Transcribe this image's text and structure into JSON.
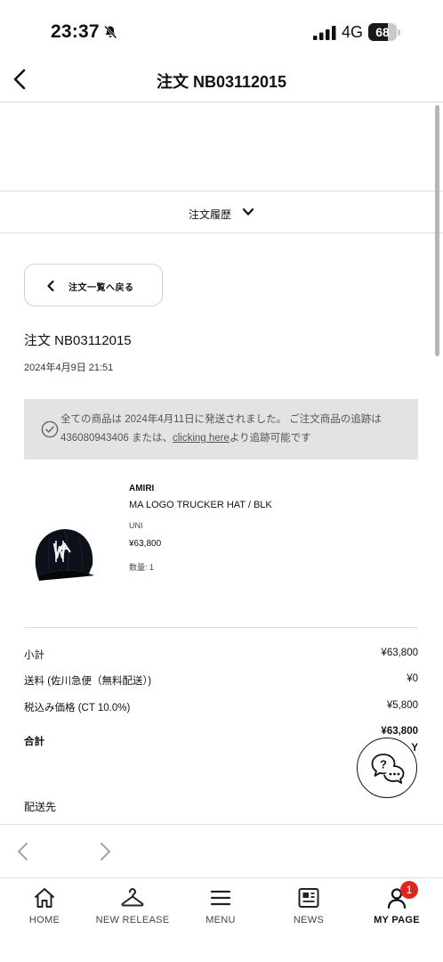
{
  "status_bar": {
    "time": "23:37",
    "network": "4G",
    "battery_level": "68",
    "battery_fraction": 0.68,
    "icons": [
      "bell-slash-icon",
      "signal-icon"
    ]
  },
  "header": {
    "title": "注文 NB03112015",
    "back_icon": "chevron-left-icon"
  },
  "history_dropdown": {
    "label": "注文履歴"
  },
  "back_to_list": {
    "label": "注文一覧へ戻る"
  },
  "order": {
    "number": "注文 NB03112015",
    "date": "2024年4月9日 21:51"
  },
  "shipping_notice": {
    "text_before_link": "全ての商品は 2024年4月11日に発送されました。 ご注文商品の追跡は 436080943406 または、",
    "link_label": "clicking here",
    "text_after_link": "より追跡可能です"
  },
  "product": {
    "brand": "AMIRI",
    "name": "MA LOGO TRUCKER HAT / BLK",
    "size": "UNI",
    "price": "¥63,800",
    "quantity": "数量: 1",
    "image_icon": "trucker-hat-image"
  },
  "summary": {
    "rows": [
      {
        "label": "小計",
        "value": "¥63,800"
      },
      {
        "label": "送料 (佐川急便（無料配送）)",
        "value": "¥0"
      },
      {
        "label": "税込み価格 (CT 10.0%)",
        "value": "¥5,800"
      }
    ],
    "total_label": "合計",
    "total_value": "¥63,800",
    "total_suffix": "Y"
  },
  "ship_to": {
    "label": "配送先"
  },
  "tab_bar": {
    "items": [
      {
        "label": "HOME",
        "icon": "home-icon"
      },
      {
        "label": "NEW RELEASE",
        "icon": "hanger-icon"
      },
      {
        "label": "MENU",
        "icon": "menu-icon"
      },
      {
        "label": "NEWS",
        "icon": "news-icon"
      },
      {
        "label": "MY PAGE",
        "icon": "user-icon",
        "badge": "1"
      }
    ],
    "active": "MY PAGE"
  },
  "colors": {
    "badge": "#e0251e",
    "notice_bg": "#e3e3e3",
    "divider": "#dcdcdc"
  }
}
